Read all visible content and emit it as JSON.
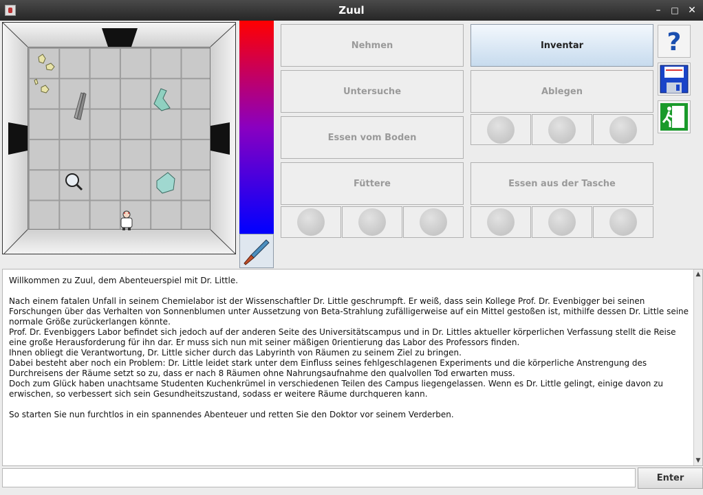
{
  "window": {
    "title": "Zuul"
  },
  "buttons": {
    "take": "Nehmen",
    "inventory": "Inventar",
    "examine": "Untersuche",
    "drop": "Ablegen",
    "eat_floor": "Essen vom Boden",
    "feed": "Füttere",
    "eat_bag": "Essen aus der Tasche"
  },
  "health": {
    "level": 1.0
  },
  "icons": {
    "help": "question-mark-icon",
    "save": "floppy-disk-icon",
    "exit": "exit-sign-icon"
  },
  "log": {
    "paragraphs": [
      "Willkommen zu Zuul, dem Abenteuerspiel mit Dr. Little.",
      "",
      "Nach einem fatalen Unfall in seinem Chemielabor ist der Wissenschaftler Dr. Little geschrumpft. Er weiß, dass sein Kollege Prof. Dr. Evenbigger bei seinen Forschungen über das Verhalten von Sonnenblumen unter Aussetzung von Beta-Strahlung zufälligerweise auf ein Mittel gestoßen ist, mithilfe dessen Dr. Little seine normale Größe zurückerlangen könnte.",
      "Prof. Dr. Evenbiggers Labor befindet sich jedoch auf der anderen Seite des Universitätscampus und in Dr. Littles aktueller körperlichen Verfassung stellt die Reise eine große Herausforderung für ihn dar. Er muss sich nun mit seiner mäßigen 0rientierung das Labor des Professors finden.",
      "Ihnen obliegt die Verantwortung, Dr. Little sicher durch das Labyrinth von Räumen zu seinem Ziel zu bringen.",
      "Dabei besteht aber noch ein Problem: Dr. Little leidet stark unter dem Einfluss seines fehlgeschlagenen Experiments und die körperliche Anstrengung des Durchreisens der Räume setzt so zu, dass er nach 8 Räumen ohne Nahrungsaufnahme den qualvollen Tod erwarten muss.",
      "Doch zum Glück haben unachtsame Studenten Kuchenkrümel in verschiedenen Teilen des Campus liegengelassen. Wenn es Dr. Little gelingt, einige davon zu erwischen, so verbessert sich sein Gesundheitszustand, sodass er weitere Räume durchqueren kann.",
      "",
      "So starten Sie nun furchtlos in ein spannendes Abenteuer und retten Sie den Doktor vor seinem Verderben."
    ]
  },
  "command": {
    "value": "",
    "enter_label": "Enter"
  }
}
